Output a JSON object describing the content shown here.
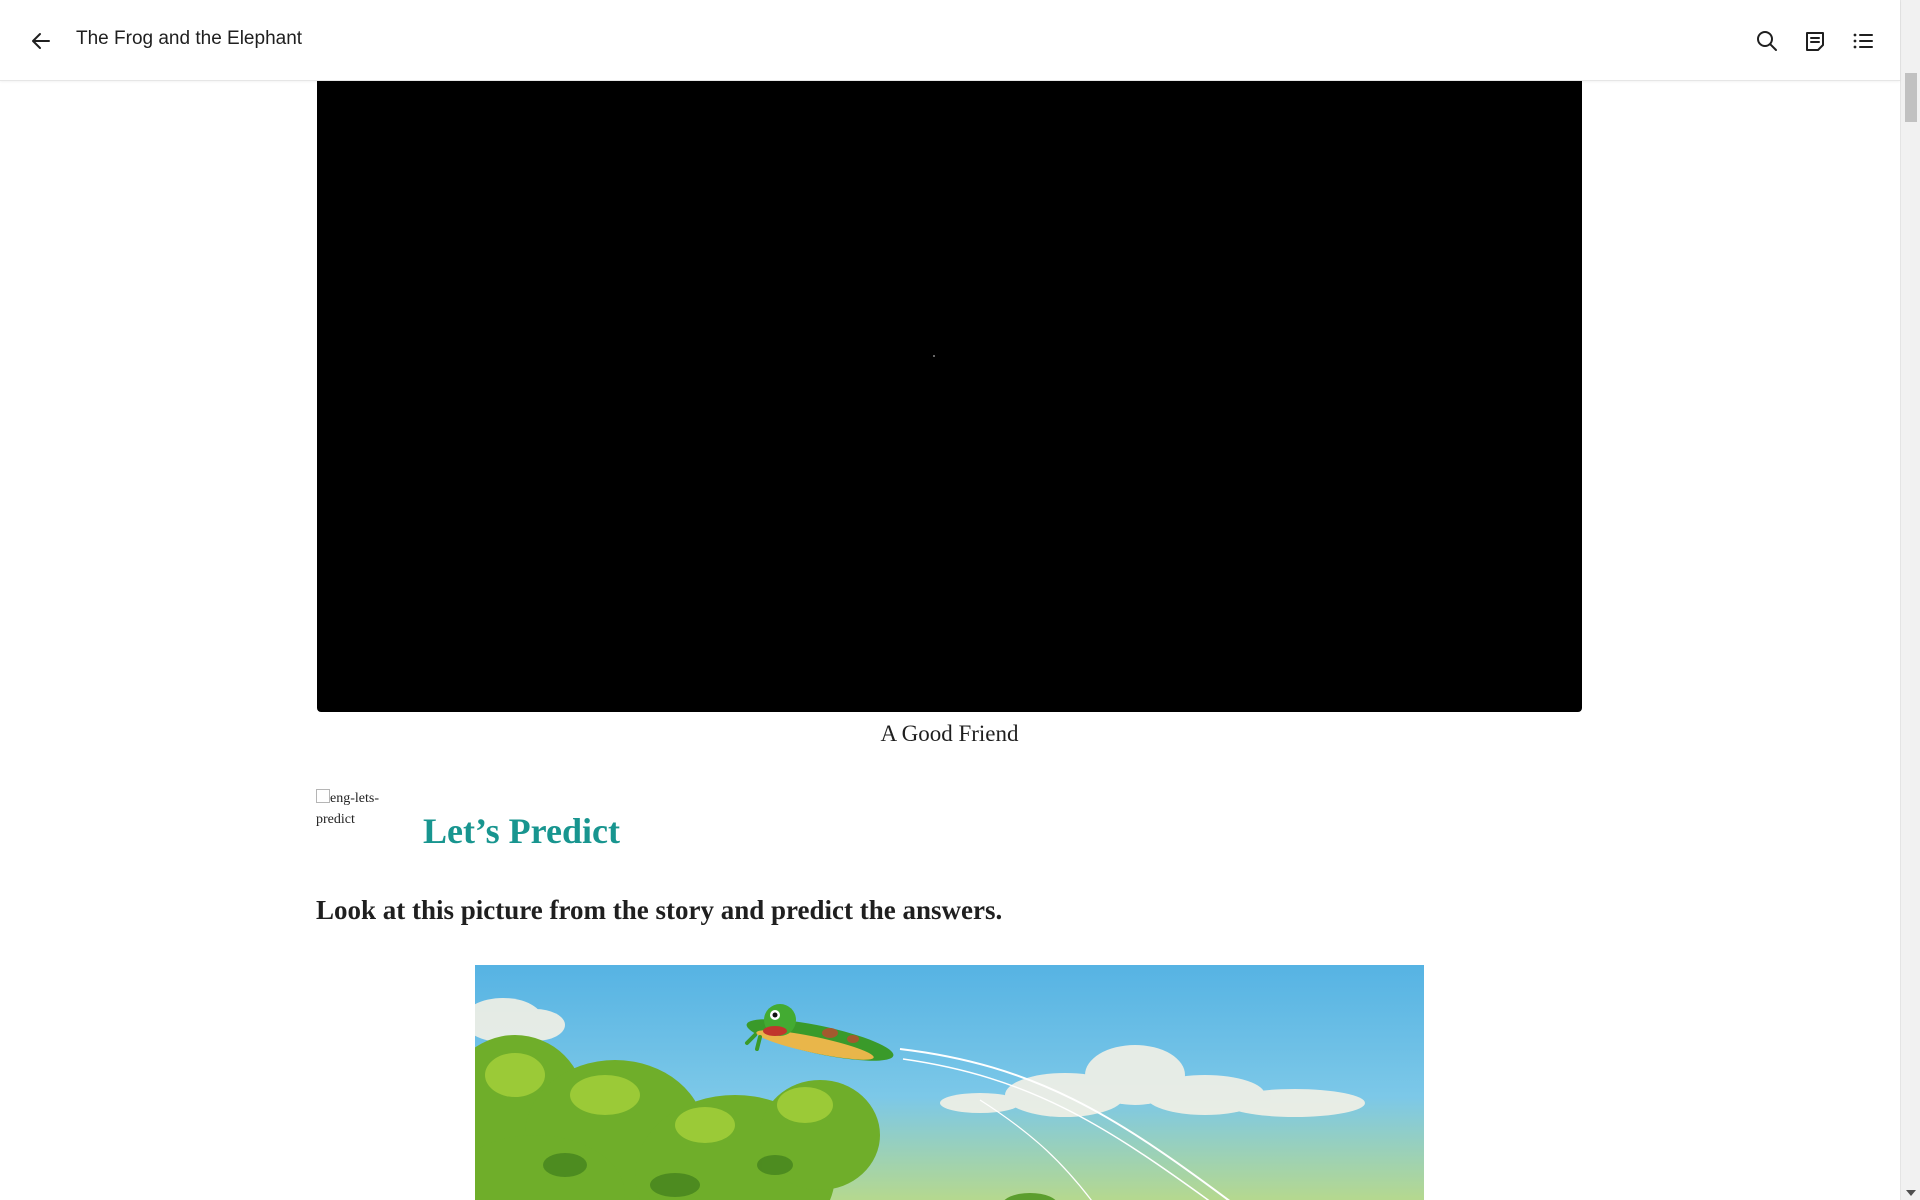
{
  "header": {
    "title": "The Frog and the Elephant",
    "icons": [
      "back-arrow-icon",
      "search-icon",
      "notes-icon",
      "table-of-contents-icon"
    ]
  },
  "main": {
    "video_caption": "A Good Friend",
    "broken_image_alt": "eng-lets-predict",
    "section_heading": "Let’s Predict",
    "instruction": "Look at this picture from the story and predict the answers."
  },
  "colors": {
    "heading_accent": "#18958f",
    "sky": "#5db8e6",
    "foliage": "#6fae2a"
  }
}
